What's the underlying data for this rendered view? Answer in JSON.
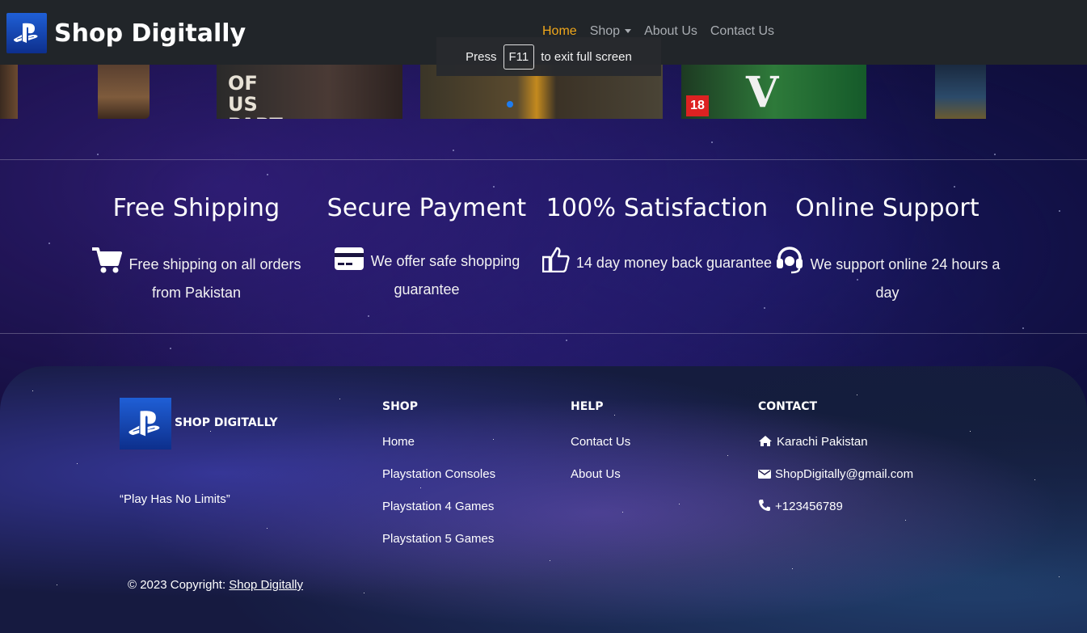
{
  "navbar": {
    "brand": "Shop Digitally",
    "links": [
      {
        "label": "Home",
        "active": true
      },
      {
        "label": "Shop",
        "dropdown": true
      },
      {
        "label": "About Us"
      },
      {
        "label": "Contact Us"
      }
    ],
    "accent_color": "#f0a71b"
  },
  "fullscreen_toast": {
    "press": "Press",
    "key": "F11",
    "message": "to exit full screen"
  },
  "carousel": {
    "slides": [
      {
        "text": ""
      },
      {
        "text": ""
      },
      {
        "text": "OF US PART II"
      },
      {
        "text": ""
      },
      {
        "text": "18"
      },
      {
        "text": ""
      }
    ]
  },
  "features": [
    {
      "title": "Free Shipping",
      "icon": "cart-icon",
      "text": "Free shipping on all orders from Pakistan"
    },
    {
      "title": "Secure Payment",
      "icon": "credit-card-icon",
      "text": "We offer safe shopping guarantee"
    },
    {
      "title": "100% Satisfaction",
      "icon": "thumbs-up-icon",
      "text": "14 day money back guarantee"
    },
    {
      "title": "Online Support",
      "icon": "headset-icon",
      "text": "We support online 24 hours a day"
    }
  ],
  "footer": {
    "brand": "SHOP DIGITALLY",
    "tagline": "“Play Has No Limits”",
    "shop": {
      "heading": "SHOP",
      "links": [
        "Home",
        "Playstation Consoles",
        "Playstation 4 Games",
        "Playstation 5 Games"
      ]
    },
    "help": {
      "heading": "HELP",
      "links": [
        "Contact Us",
        "About Us"
      ]
    },
    "contact": {
      "heading": "CONTACT",
      "address": "Karachi Pakistan",
      "email": "ShopDigitally@gmail.com",
      "phone": "+123456789"
    },
    "copyright_prefix": "© 2023 Copyright:",
    "copyright_link": "Shop Digitally"
  }
}
